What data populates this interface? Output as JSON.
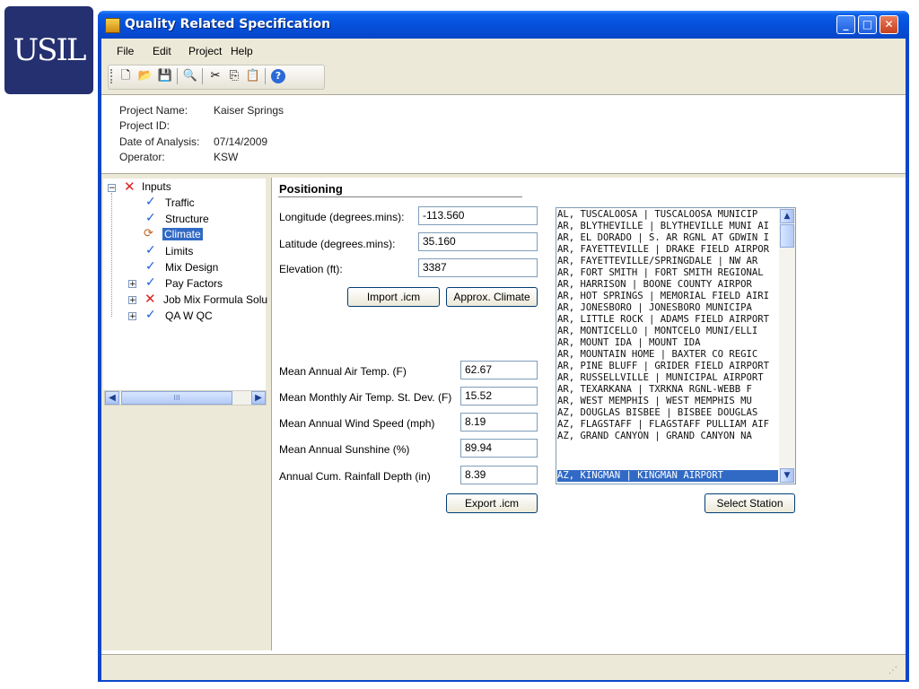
{
  "logo": {
    "text": "USIL"
  },
  "window": {
    "title": "Quality Related Specification",
    "minimize": "_",
    "maximize": "□",
    "close": "✕"
  },
  "menu": [
    "File",
    "Edit",
    "Project",
    "Help"
  ],
  "toolbar": {
    "new": "🗋",
    "open": "📂",
    "save": "💾",
    "preview": "🔍",
    "cut": "✂",
    "copy": "⎘",
    "paste": "📋",
    "help": "?"
  },
  "project": {
    "name_label": "Project Name:",
    "name_value": "Kaiser Springs",
    "id_label": "Project ID:",
    "id_value": "",
    "date_label": "Date of Analysis:",
    "date_value": "07/14/2009",
    "operator_label": "Operator:",
    "operator_value": "KSW"
  },
  "tree": {
    "root": "Inputs",
    "items": [
      "Traffic",
      "Structure",
      "Climate",
      "Limits",
      "Mix Design",
      "Pay Factors",
      "Job Mix Formula Solu",
      "QA W QC"
    ],
    "scroll_thumb": "III"
  },
  "positioning": {
    "title": "Positioning",
    "longitude_label": "Longitude (degrees.mins):",
    "longitude_value": "-113.560",
    "latitude_label": "Latitude (degrees.mins):",
    "latitude_value": "35.160",
    "elevation_label": "Elevation (ft):",
    "elevation_value": "3387",
    "import_button": "Import .icm",
    "approx_button": "Approx. Climate"
  },
  "climate": {
    "air_temp_label": "Mean Annual Air Temp. (F)",
    "air_temp_value": "62.67",
    "temp_dev_label": "Mean Monthly Air Temp. St. Dev. (F)",
    "temp_dev_value": "15.52",
    "wind_label": "Mean Annual Wind Speed (mph)",
    "wind_value": "8.19",
    "sunshine_label": "Mean Annual Sunshine (%)",
    "sunshine_value": "89.94",
    "rainfall_label": "Annual Cum. Rainfall Depth (in)",
    "rainfall_value": "8.39",
    "export_button": "Export .icm"
  },
  "stations": {
    "items": [
      "AL, TUSCALOOSA | TUSCALOOSA MUNICIP",
      "AR, BLYTHEVILLE | BLYTHEVILLE MUNI AI",
      "AR, EL DORADO | S. AR RGNL AT GDWIN I",
      "AR, FAYETTEVILLE | DRAKE FIELD AIRPOR",
      "AR, FAYETTEVILLE/SPRINGDALE | NW AR",
      "AR, FORT SMITH | FORT SMITH REGIONAL",
      "AR, HARRISON | BOONE COUNTY AIRPOR",
      "AR, HOT SPRINGS | MEMORIAL FIELD AIRI",
      "AR, JONESBORO | JONESBORO MUNICIPA",
      "AR, LITTLE ROCK | ADAMS FIELD AIRPORT",
      "AR, MONTICELLO | MONTCELO MUNI/ELLI",
      "AR, MOUNT IDA | MOUNT IDA",
      "AR, MOUNTAIN HOME | BAXTER CO REGIC",
      "AR, PINE BLUFF | GRIDER FIELD AIRPORT",
      "AR, RUSSELLVILLE | MUNICIPAL AIRPORT",
      "AR, TEXARKANA | TXRKNA RGNL-WEBB F",
      "AR, WEST MEMPHIS | WEST MEMPHIS MU",
      "AZ, DOUGLAS BISBEE | BISBEE DOUGLAS",
      "AZ, FLAGSTAFF | FLAGSTAFF PULLIAM AIF",
      "AZ, GRAND CANYON | GRAND CANYON NA",
      "AZ, KINGMAN | KINGMAN AIRPORT"
    ],
    "selected_index": 20,
    "select_button": "Select Station",
    "scroll_up": "▲",
    "scroll_down": "▼"
  }
}
